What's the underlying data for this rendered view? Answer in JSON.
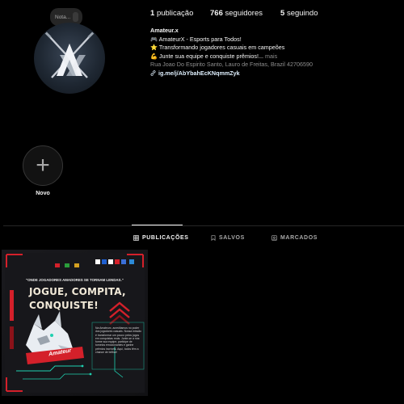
{
  "note": {
    "label": "Nota..."
  },
  "stats": {
    "posts_count": "1",
    "posts_label": "publicação",
    "followers_count": "766",
    "followers_label": "seguidores",
    "following_count": "5",
    "following_label": "seguindo"
  },
  "bio": {
    "username": "Amateur.x",
    "line1_icon": "🎮",
    "line1": "AmateurX - Esports para Todos!",
    "line2_icon": "⭐",
    "line2": "Transformando jogadores casuais em campeões",
    "line3_icon": "💪",
    "line3": "Junte sua equipe e conquiste prêmios!...",
    "more": "mais",
    "address": "Rua Joao Do Espirito Santo, Lauro de Freitas, Brazil 42706590",
    "link": "ig.me/j/AbYbahEcKNqmmZyk"
  },
  "highlight": {
    "label": "Novo"
  },
  "tabs": [
    {
      "label": "PUBLICAÇÕES",
      "icon": "grid-icon"
    },
    {
      "label": "SALVOS",
      "icon": "bookmark-icon"
    },
    {
      "label": "MARCADOS",
      "icon": "tagged-icon"
    }
  ],
  "post": {
    "tagline": "\"ONDE JOGADORES AMADORES SE TORNAM LENDAS.\"",
    "headline_line1": "JOGUE, COMPITA,",
    "headline_line2": "CONQUISTE!",
    "brand": "Amateur",
    "body": "Na Amateurx, acreditamos no poder dos jogadores casuais. Nossa missão é transformar um pouco pelos jogos em conquistas reais. Junte-se a nós: forme sua equipe, participe de torneios emocionantes e ganhe prêmios incríveis. Aqui, todos têm a chance de brilhar!"
  },
  "colors": {
    "accent_red": "#d4202a",
    "accent_green": "#1fd0b0",
    "bg": "#000000",
    "text": "#f5f5f5",
    "muted": "#8e8e8e"
  }
}
